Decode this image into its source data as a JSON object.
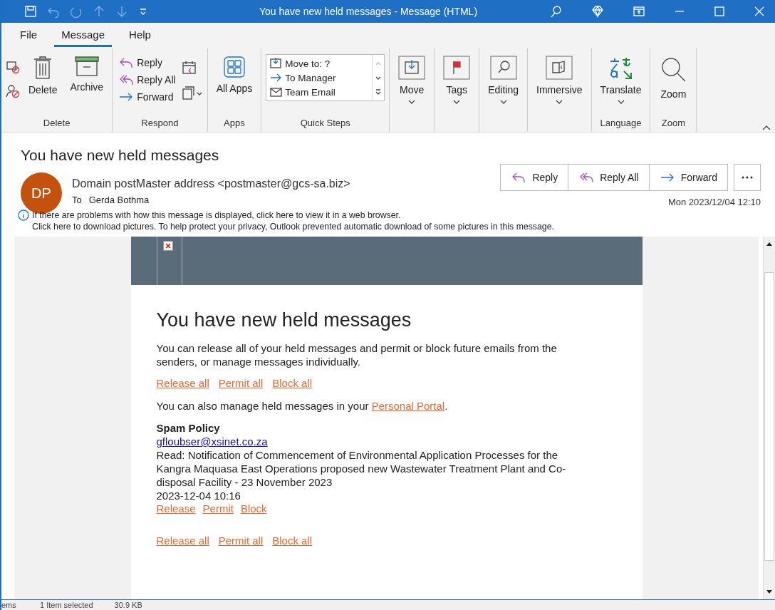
{
  "window": {
    "title": "You have new held messages  -  Message (HTML)"
  },
  "menu_tabs": [
    {
      "label": "File",
      "selected": false
    },
    {
      "label": "Message",
      "selected": true
    },
    {
      "label": "Help",
      "selected": false
    }
  ],
  "ribbon": {
    "groups": [
      {
        "label": "Delete",
        "buttons": [
          {
            "kind": "icon"
          },
          {
            "kind": "icon"
          },
          {
            "kind": "large",
            "label": "Delete"
          },
          {
            "kind": "large",
            "label": "Archive"
          }
        ]
      },
      {
        "label": "Respond",
        "buttons": [
          {
            "kind": "small",
            "label": "Reply"
          },
          {
            "kind": "small",
            "label": "Reply All"
          },
          {
            "kind": "small",
            "label": "Forward"
          },
          {
            "kind": "icon"
          },
          {
            "kind": "icon"
          }
        ]
      },
      {
        "label": "Apps",
        "buttons": [
          {
            "kind": "large",
            "label": "All Apps"
          }
        ]
      },
      {
        "label": "Quick Steps",
        "buttons": [
          {
            "kind": "quicksteps",
            "items": [
              "Move to: ?",
              "To Manager",
              "Team Email"
            ]
          }
        ]
      },
      {
        "buttons": [
          {
            "kind": "menu",
            "label": "Move"
          }
        ]
      },
      {
        "buttons": [
          {
            "kind": "menu",
            "label": "Tags"
          }
        ]
      },
      {
        "buttons": [
          {
            "kind": "menu",
            "label": "Editing"
          }
        ]
      },
      {
        "buttons": [
          {
            "kind": "menu",
            "label": "Immersive"
          }
        ]
      },
      {
        "label": "Language",
        "buttons": [
          {
            "kind": "menu",
            "label": "Translate"
          }
        ]
      },
      {
        "label": "Zoom",
        "buttons": [
          {
            "kind": "large",
            "label": "Zoom"
          }
        ]
      }
    ]
  },
  "message": {
    "subject": "You have new held messages",
    "avatar": "DP",
    "sender": "Domain postMaster address <postmaster@gcs-sa.biz>",
    "to_label": "To",
    "to": "Gerda Bothma",
    "actions": [
      "Reply",
      "Reply All",
      "Forward"
    ],
    "date": "Mon 2023/12/04 12:10",
    "info_lines": [
      "If there are problems with how this message is displayed, click here to view it in a web browser.",
      "Click here to download pictures. To help protect your privacy, Outlook prevented automatic download of some pictures in this message."
    ]
  },
  "body": {
    "heading": "You have new held messages",
    "intro": "You can release all of your held messages and permit or block future emails from the senders, or manage messages individually.",
    "top_links": [
      "Release all",
      "Permit all",
      "Block all"
    ],
    "portal_text": "You can also manage held messages in your",
    "portal_link": "Personal Portal",
    "portal_end": ".",
    "section_title": "Spam Policy",
    "items": [
      {
        "sender": "gfloubser@xsinet.co.za",
        "subject": "Read: Notification of Commencement of Environmental Application Processes for the Kangra Maquasa East Operations proposed new Wastewater Treatment Plant and Co-disposal Facility - 23 November 2023",
        "time": "2023-12-04 10:16",
        "links": [
          "Release",
          "Permit",
          "Block"
        ]
      }
    ],
    "bottom_links": [
      "Release all",
      "Permit all",
      "Block all"
    ]
  },
  "status_bar": [
    "ems",
    "1 Item selected",
    "30.9 KB"
  ]
}
